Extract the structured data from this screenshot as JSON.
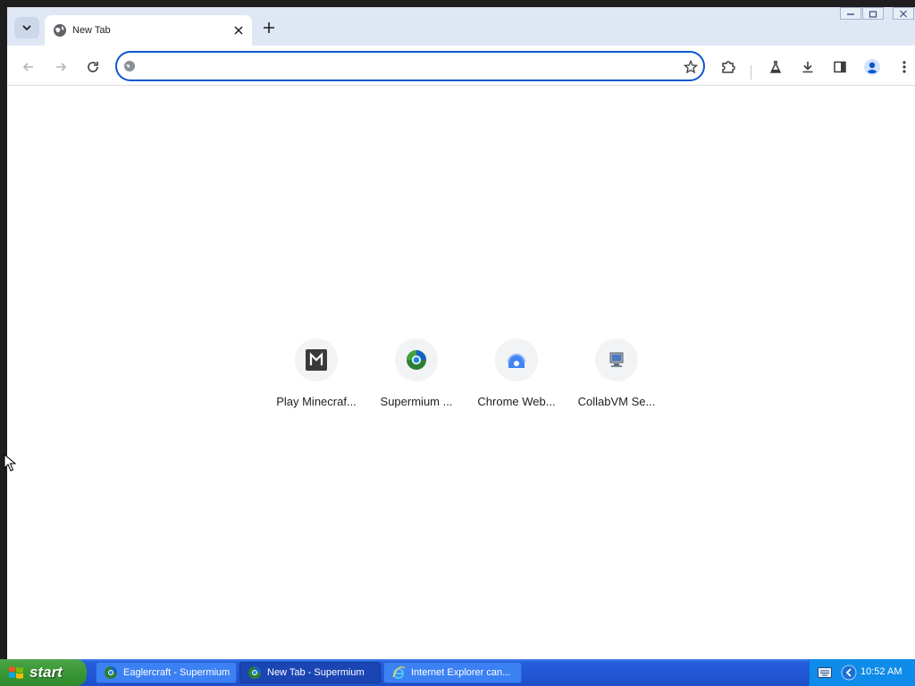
{
  "browser": {
    "tab": {
      "title": "New Tab"
    },
    "omnibox": {
      "value": "",
      "placeholder": ""
    },
    "accent_color": "#0b57d0"
  },
  "shortcuts": [
    {
      "label": "Play Minecraf...",
      "icon": "minecraft-m-icon"
    },
    {
      "label": "Supermium ...",
      "icon": "supermium-icon"
    },
    {
      "label": "Chrome Web...",
      "icon": "chrome-web-store-icon"
    },
    {
      "label": "CollabVM Se...",
      "icon": "collabvm-icon"
    }
  ],
  "taskbar": {
    "start_label": "start",
    "tasks": [
      {
        "label": "Eaglercraft - Supermium",
        "active": false,
        "icon": "supermium-icon"
      },
      {
        "label": "New Tab - Supermium",
        "active": true,
        "icon": "supermium-icon"
      },
      {
        "label": "Internet Explorer can...",
        "active": false,
        "icon": "internet-explorer-icon"
      }
    ],
    "clock": "10:52 AM"
  }
}
